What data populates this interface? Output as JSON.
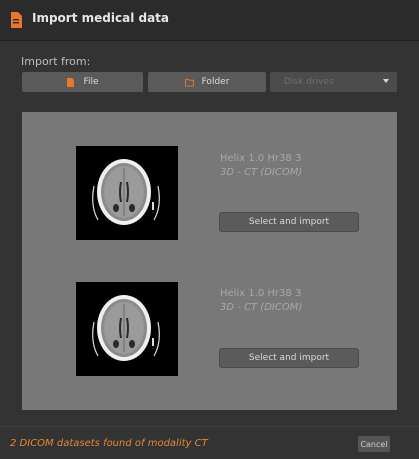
{
  "window": {
    "title": "Import medical data",
    "title_icon": "document-icon"
  },
  "import_from": {
    "label": "Import from:",
    "file_label": "File",
    "file_icon": "file-icon",
    "folder_label": "Folder",
    "folder_icon": "folder-icon",
    "disk_select_placeholder": "Disk drives"
  },
  "datasets": [
    {
      "name": "Helix 1.0 Hr38 3",
      "type": "3D - CT (DICOM)",
      "button": "Select and import"
    },
    {
      "name": "Helix 1.0 Hr38 3",
      "type": "3D - CT (DICOM)",
      "button": "Select and import"
    }
  ],
  "footer": {
    "status": "2 DICOM datasets found of modality CT",
    "cancel_label": "Cancel"
  },
  "colors": {
    "accent": "#e8772e",
    "panel": "#787878",
    "background": "#333333"
  }
}
